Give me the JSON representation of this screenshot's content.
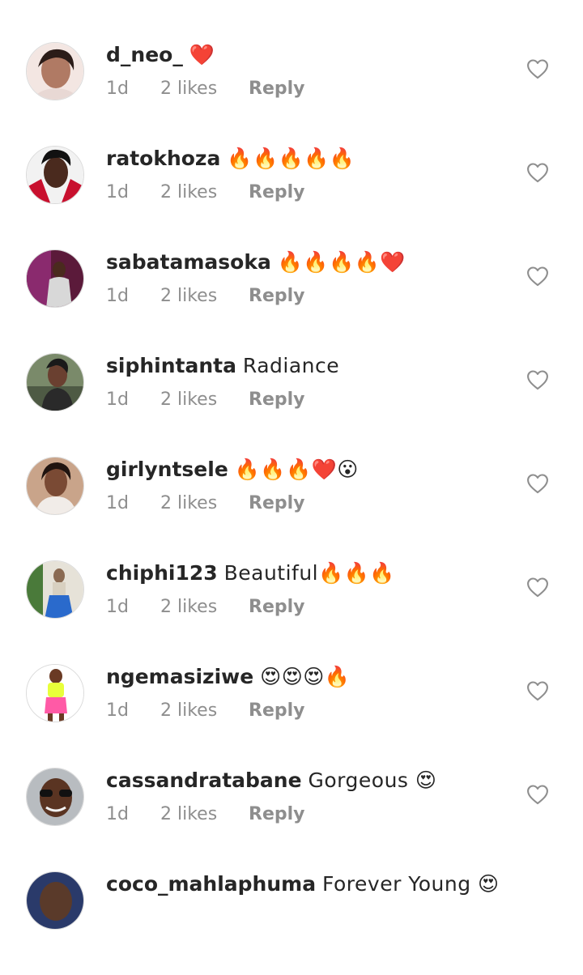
{
  "comments": [
    {
      "username": "d_neo_",
      "text": "❤️",
      "time": "1d",
      "likes": "2 likes",
      "reply": "Reply"
    },
    {
      "username": "ratokhoza",
      "text": "🔥🔥🔥🔥🔥",
      "time": "1d",
      "likes": "2 likes",
      "reply": "Reply"
    },
    {
      "username": "sabatamasoka",
      "text": "🔥🔥🔥🔥❤️",
      "time": "1d",
      "likes": "2 likes",
      "reply": "Reply"
    },
    {
      "username": "siphintanta",
      "text": "Radiance",
      "time": "1d",
      "likes": "2 likes",
      "reply": "Reply"
    },
    {
      "username": "girlyntsele",
      "text": "🔥🔥🔥❤️😮",
      "time": "1d",
      "likes": "2 likes",
      "reply": "Reply"
    },
    {
      "username": "chiphi123",
      "text": "Beautiful🔥🔥🔥",
      "time": "1d",
      "likes": "2 likes",
      "reply": "Reply"
    },
    {
      "username": "ngemasiziwe",
      "text": "😍😍😍🔥",
      "time": "1d",
      "likes": "2 likes",
      "reply": "Reply"
    },
    {
      "username": "cassandratabane",
      "text": "Gorgeous 😍",
      "time": "1d",
      "likes": "2 likes",
      "reply": "Reply"
    },
    {
      "username": "coco_mahlaphuma",
      "text": "Forever Young 😍",
      "time": "",
      "likes": "",
      "reply": ""
    }
  ],
  "icons": {
    "like": "heart-outline-icon"
  },
  "colors": {
    "text": "#262626",
    "meta": "#8e8e8e",
    "border": "#dbdbdb"
  }
}
